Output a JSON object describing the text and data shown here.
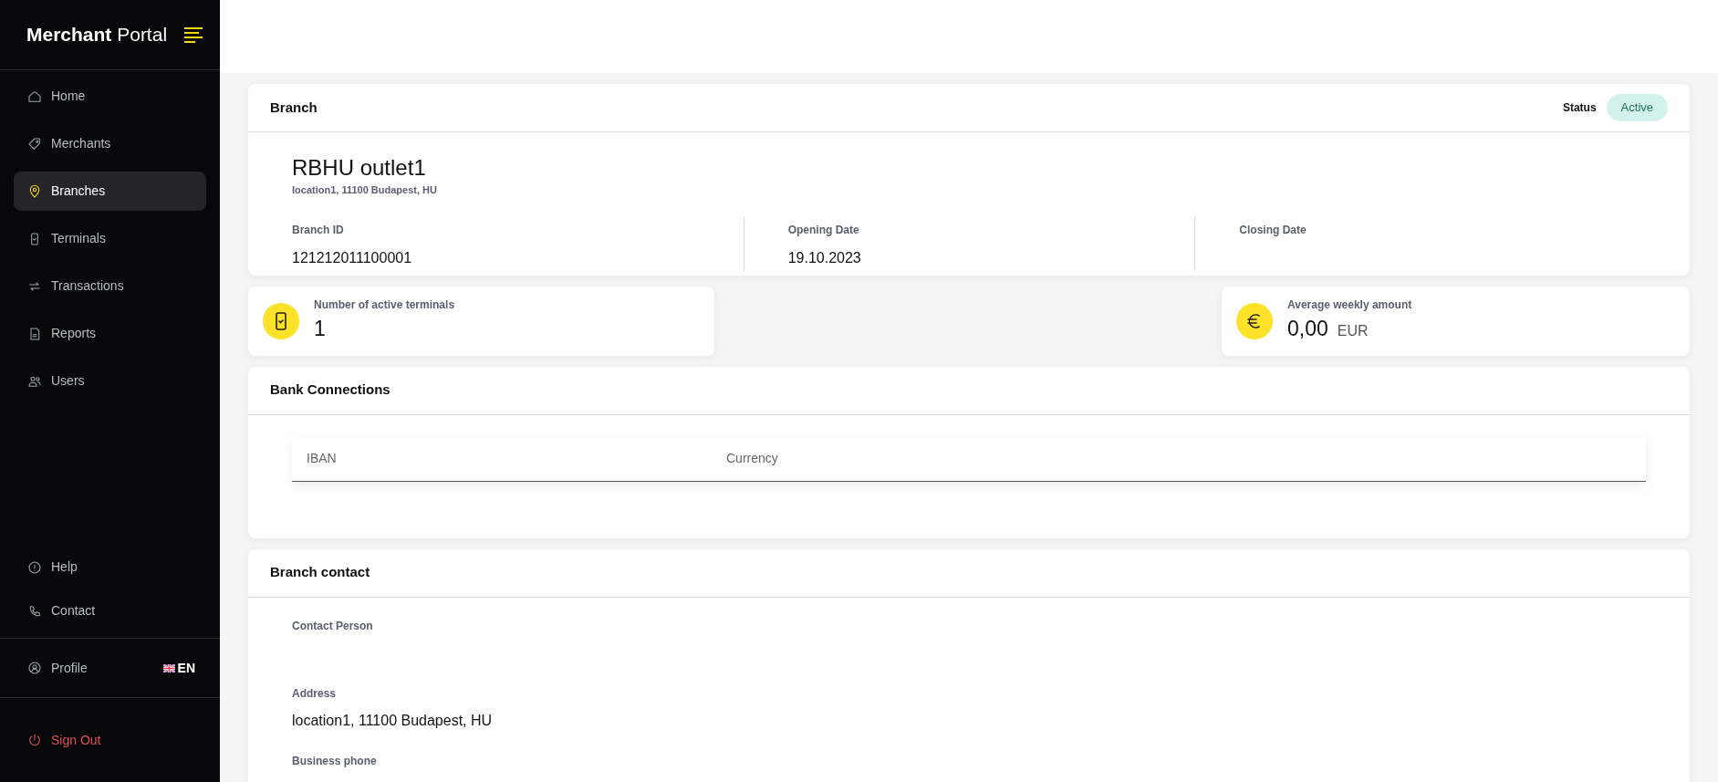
{
  "sidebar": {
    "logo_bold": "Merchant",
    "logo_light": "Portal",
    "items": [
      {
        "label": "Home",
        "selected": false
      },
      {
        "label": "Merchants",
        "selected": false
      },
      {
        "label": "Branches",
        "selected": true
      },
      {
        "label": "Terminals",
        "selected": false
      },
      {
        "label": "Transactions",
        "selected": false
      },
      {
        "label": "Reports",
        "selected": false
      },
      {
        "label": "Users",
        "selected": false
      }
    ],
    "bottom_items": [
      {
        "label": "Help"
      },
      {
        "label": "Contact"
      }
    ],
    "profile": "Profile",
    "language": "EN",
    "sign_out": "Sign Out"
  },
  "branch": {
    "title": "Branch",
    "status_label": "Status",
    "status": "Active",
    "name": "RBHU outlet1",
    "address": "location1, 11100 Budapest, HU",
    "fields": [
      {
        "label": "Branch ID",
        "value": "121212011100001"
      },
      {
        "label": "Opening Date",
        "value": "19.10.2023"
      },
      {
        "label": "Closing Date"
      }
    ]
  },
  "stats": [
    {
      "label": "Number of active terminals",
      "value": "1"
    },
    {
      "label": "Average weekly amount",
      "value": "0,00",
      "unit": "EUR"
    }
  ],
  "bank_connections": {
    "title": "Bank Connections",
    "columns": [
      "IBAN",
      "Currency"
    ]
  },
  "branch_contact": {
    "title": "Branch contact",
    "fields": [
      {
        "label": "Contact Person"
      },
      {
        "label": "Address",
        "value": "location1, 11100 Budapest, HU"
      },
      {
        "label": "Business phone"
      }
    ]
  }
}
